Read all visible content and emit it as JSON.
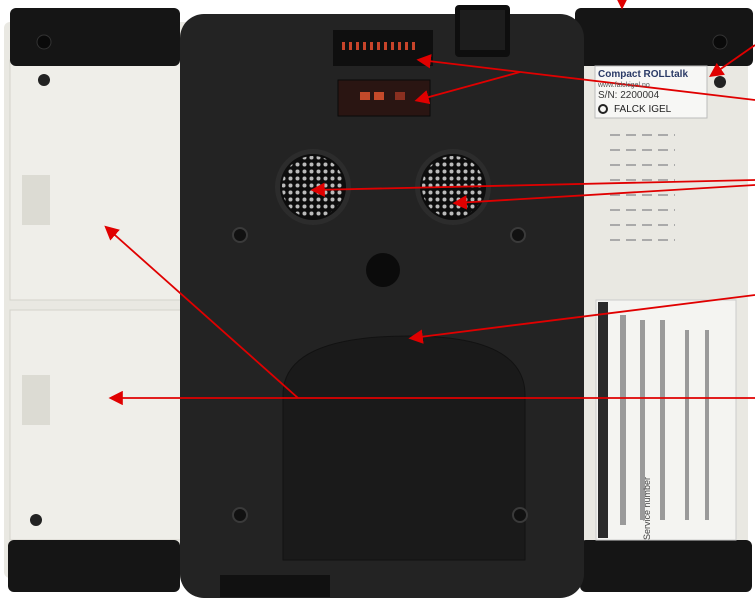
{
  "device": {
    "sticker_model": "Compact ROLLtalk",
    "sticker_web": "www.falckigel.no",
    "sticker_serial": "S/N: 2200004",
    "sticker_brand": "FALCK IGEL",
    "service_label": "Service number"
  },
  "colors": {
    "housing_light": "#ecebe6",
    "housing_dark": "#1f1f1f",
    "bumper": "#151515",
    "arrow": "#e00000"
  }
}
